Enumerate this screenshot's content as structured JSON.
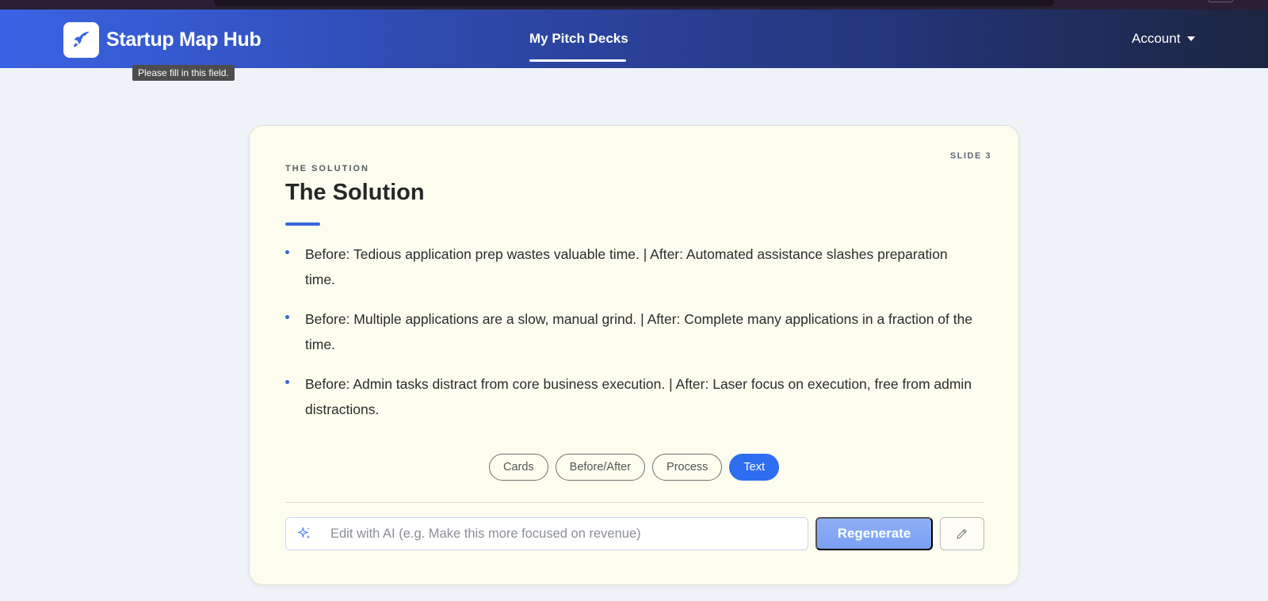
{
  "navbar": {
    "brand_name": "Startup Map Hub",
    "brand_icon": "rocket-icon",
    "nav_link": "My Pitch Decks",
    "account_label": "Account",
    "tooltip": "Please fill in this field."
  },
  "slide": {
    "number_label": "SLIDE 3",
    "eyebrow": "THE SOLUTION",
    "title": "The Solution",
    "bullets": [
      "Before: Tedious application prep wastes valuable time. | After: Automated assistance slashes preparation time.",
      "Before: Multiple applications are a slow, manual grind. | After: Complete many applications in a fraction of the time.",
      "Before: Admin tasks distract from core business execution. | After: Laser focus on execution, free from admin distractions."
    ],
    "layouts": [
      "Cards",
      "Before/After",
      "Process",
      "Text"
    ],
    "active_layout": "Text"
  },
  "editor": {
    "placeholder": "Edit with AI (e.g. Make this more focused on revenue)",
    "regenerate_label": "Regenerate",
    "sparkle_icon": "sparkle-icon",
    "edit_icon": "pencil-icon"
  },
  "colors": {
    "accent": "#2f6df0",
    "card_bg": "#fdfdef"
  }
}
